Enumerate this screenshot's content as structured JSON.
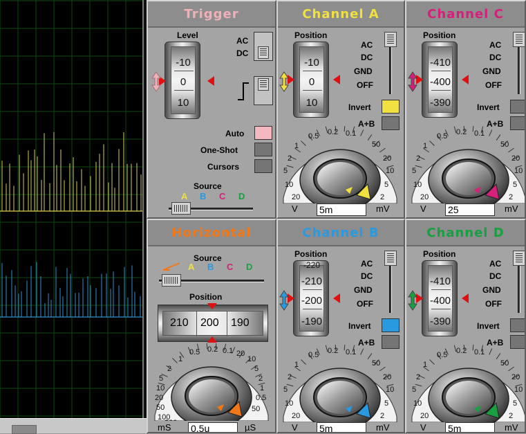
{
  "colors": {
    "A": "#f0e040",
    "B": "#2a9ae0",
    "C": "#d4207a",
    "D": "#18a040",
    "trigger": "#f0b0b8",
    "horizontal": "#f07818"
  },
  "trigger": {
    "title": "Trigger",
    "level_label": "Level",
    "ac": "AC",
    "dc": "DC",
    "wheel": [
      "-10",
      "0",
      "10"
    ],
    "auto": "Auto",
    "one_shot": "One-Shot",
    "cursors": "Cursors",
    "source_label": "Source",
    "sources": [
      "A",
      "B",
      "C",
      "D"
    ]
  },
  "horizontal": {
    "title": "Horizontal",
    "source_label": "Source",
    "sources": [
      "A",
      "B",
      "C",
      "D"
    ],
    "position_label": "Position",
    "readout": [
      "210",
      "200",
      "190"
    ],
    "dial_labels": [
      "0.5",
      "0.2",
      "0.1",
      "1",
      "2",
      "5",
      "10",
      "20",
      "50",
      "100",
      "200",
      "5",
      "2",
      "1",
      "0.5",
      "10",
      "20",
      "50"
    ],
    "value": "0.5u",
    "unit_left": "mS",
    "unit_right": "µS"
  },
  "channels": [
    {
      "title": "Channel A",
      "key": "A",
      "position_label": "Position",
      "modes": [
        "AC",
        "DC",
        "GND",
        "OFF"
      ],
      "wheel": [
        "-10",
        "0",
        "10"
      ],
      "invert": "Invert",
      "aplusb": "A+B",
      "value": "5m",
      "unit_left": "V",
      "unit_right": "mV",
      "invert_on": true
    },
    {
      "title": "Channel C",
      "key": "C",
      "position_label": "Position",
      "modes": [
        "AC",
        "DC",
        "GND",
        "OFF"
      ],
      "wheel": [
        "-410",
        "-400",
        "-390"
      ],
      "invert": "Invert",
      "aplusb": "A+B",
      "value": "25",
      "unit_left": "V",
      "unit_right": "mV",
      "invert_on": false
    },
    {
      "title": "Channel B",
      "key": "B",
      "position_label": "Position",
      "modes": [
        "AC",
        "DC",
        "GND",
        "OFF"
      ],
      "wheel": [
        "-210",
        "-200",
        "-190"
      ],
      "wheel_top": "-220",
      "invert": "Invert",
      "aplusb": "A+B",
      "value": "5m",
      "unit_left": "V",
      "unit_right": "mV",
      "invert_on": true
    },
    {
      "title": "Channel D",
      "key": "D",
      "position_label": "Position",
      "modes": [
        "AC",
        "DC",
        "GND",
        "OFF"
      ],
      "wheel": [
        "-410",
        "-400",
        "-390"
      ],
      "invert": "Invert",
      "aplusb": "A+B",
      "value": "5m",
      "unit_left": "V",
      "unit_right": "mV",
      "invert_on": false
    }
  ],
  "volt_dial_labels": [
    "0.5",
    "0.2",
    "0.1",
    "1",
    "50",
    "2",
    "20",
    "5",
    "10",
    "10",
    "5",
    "20",
    "2"
  ]
}
